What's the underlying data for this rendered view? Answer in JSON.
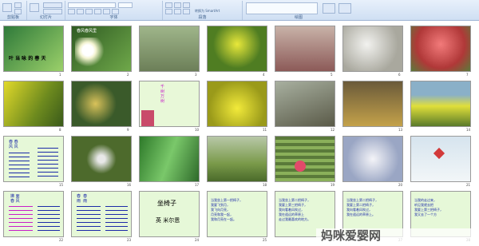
{
  "ribbon": {
    "groups": [
      "剪贴板",
      "幻灯片",
      "字体",
      "段落",
      "绘图"
    ],
    "smartart_label": "转换为 SmartArt"
  },
  "slides": [
    {
      "n": "1",
      "bg": "#2f7a3a",
      "title": "叶 当 咏 的 春 天",
      "title_color": "#ff3d3d"
    },
    {
      "n": "2",
      "bg": "#3b6b2a",
      "title": "春风春风里",
      "title_color": "#ffffff"
    },
    {
      "n": "3",
      "bg": "#8aa07a"
    },
    {
      "n": "4",
      "bg": "#4f7d22"
    },
    {
      "n": "5",
      "bg": "#a88678"
    },
    {
      "n": "6",
      "bg": "#c7c5be"
    },
    {
      "n": "7",
      "bg": "#c94a4a"
    },
    {
      "n": "8",
      "bg": "#8c9a1e"
    },
    {
      "n": "9",
      "bg": "#3a5a2a"
    },
    {
      "n": "10",
      "bg": "#e8f8d8"
    },
    {
      "n": "11",
      "bg": "#c9c720"
    },
    {
      "n": "12",
      "bg": "#7b7a68"
    },
    {
      "n": "13",
      "bg": "#4b4a3a"
    },
    {
      "n": "14",
      "bg": "#cfcf30"
    },
    {
      "n": "15",
      "bg": "#e6f8d8"
    },
    {
      "n": "16",
      "bg": "#4d6a2c"
    },
    {
      "n": "17",
      "bg": "#3d8a3a"
    },
    {
      "n": "18",
      "bg": "#7a9a4a"
    },
    {
      "n": "19",
      "bg": "#5a7a3a"
    },
    {
      "n": "20",
      "bg": "#c8d0e0"
    },
    {
      "n": "21",
      "bg": "#eef3f7"
    },
    {
      "n": "22",
      "bg": "#e6f8d8"
    },
    {
      "n": "23",
      "bg": "#e6f8d8"
    },
    {
      "n": "24",
      "bg": "#e6f8d8",
      "title": "坐椅子",
      "sub": "英 米尔恩"
    },
    {
      "n": "25",
      "bg": "#e6f8d8"
    },
    {
      "n": "26",
      "bg": "#e6f8d8"
    },
    {
      "n": "27",
      "bg": "#e6f8d8"
    },
    {
      "n": "28",
      "bg": "#e6f8d8"
    }
  ],
  "texts": {
    "s10": "千\n树\n万\n树",
    "s15a": "春 春\n风 风",
    "s22": "拂 面\n春 风",
    "s23a": "春  春\n雨  雨",
    "s25": "当我坐上第一把椅子，\n我要飞到月，\n我飞向月亮，\n月亮和我一起，\n我和月亮在一起。",
    "s26": "当我坐上第二把椅子，\n我要上第三把椅子，\n我向看着风吹过，\n我在遥远的草原上\n走过我最喜欢的地方。",
    "s27": "当我坐上第二把椅子，\n我要上第二把椅子，\n我向看着风吹过，\n我在遥远的草原上。",
    "s28": "当我的走过来，\n听见我就去把\n我要上第三把椅子，\n我又去了一个方"
  },
  "watermark": "妈咪爱婴网 www.baby611.com",
  "colors": {
    "ribbon": "#cfdff3",
    "slide_text_blue": "#1c2aa8",
    "slide_text_red": "#c81e1e"
  }
}
